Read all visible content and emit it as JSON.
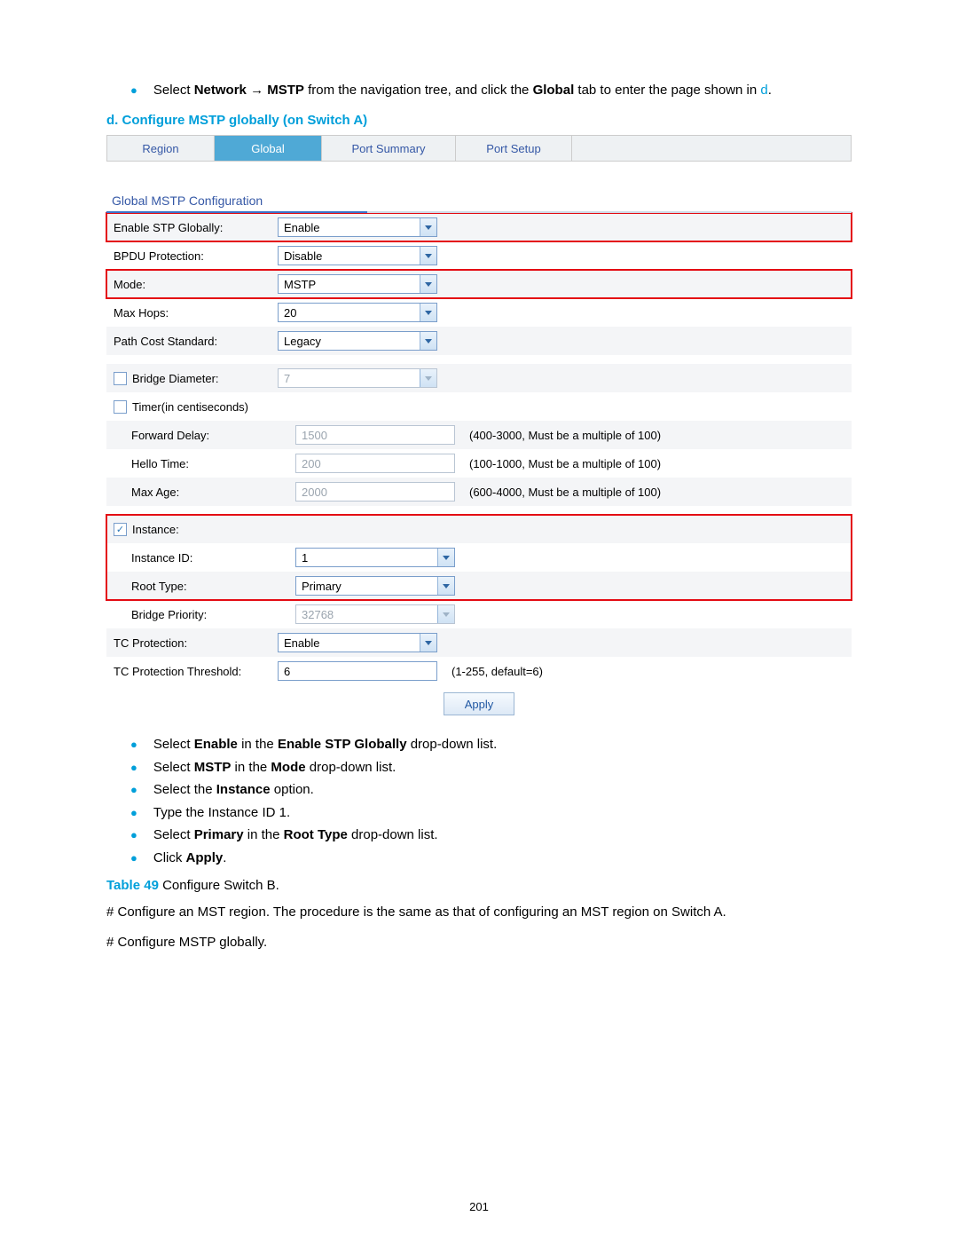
{
  "intro": {
    "pre": "Select ",
    "b1": "Network",
    "arrow": " → ",
    "b2": "MSTP",
    "mid": " from the navigation tree, and click the ",
    "b3": "Global",
    "post": " tab to enter the page shown in ",
    "link": "d",
    "dot": "."
  },
  "section_d": "d.   Configure MSTP globally (on Switch A)",
  "tabs": {
    "region": "Region",
    "global": "Global",
    "port_summary": "Port Summary",
    "port_setup": "Port Setup"
  },
  "panel_title": "Global MSTP Configuration",
  "fields": {
    "enable_stp": {
      "label": "Enable STP Globally:",
      "value": "Enable"
    },
    "bpdu": {
      "label": "BPDU Protection:",
      "value": "Disable"
    },
    "mode": {
      "label": "Mode:",
      "value": "MSTP"
    },
    "max_hops": {
      "label": "Max Hops:",
      "value": "20"
    },
    "path_cost": {
      "label": "Path Cost Standard:",
      "value": "Legacy"
    },
    "bridge_diameter": {
      "label": "Bridge Diameter:",
      "value": "7"
    },
    "timer": {
      "label": "Timer(in centiseconds)"
    },
    "fwd_delay": {
      "label": "Forward Delay:",
      "value": "1500",
      "hint": "(400-3000, Must be a multiple of 100)"
    },
    "hello": {
      "label": "Hello Time:",
      "value": "200",
      "hint": "(100-1000, Must be a multiple of 100)"
    },
    "max_age": {
      "label": "Max Age:",
      "value": "2000",
      "hint": "(600-4000, Must be a multiple of 100)"
    },
    "instance": {
      "label": "Instance:"
    },
    "instance_id": {
      "label": "Instance ID:",
      "value": "1"
    },
    "root_type": {
      "label": "Root Type:",
      "value": "Primary"
    },
    "bridge_priority": {
      "label": "Bridge Priority:",
      "value": "32768"
    },
    "tc_prot": {
      "label": "TC Protection:",
      "value": "Enable"
    },
    "tc_thresh": {
      "label": "TC Protection Threshold:",
      "value": "6",
      "hint": "(1-255, default=6)"
    }
  },
  "apply": "Apply",
  "instructions": {
    "i1": {
      "pre": "Select ",
      "b1": "Enable",
      "mid": " in the ",
      "b2": "Enable STP Globally",
      "post": " drop-down list."
    },
    "i2": {
      "pre": "Select ",
      "b1": "MSTP",
      "mid": " in the ",
      "b2": "Mode",
      "post": " drop-down list."
    },
    "i3": {
      "pre": "Select the ",
      "b1": "Instance",
      "post": " option."
    },
    "i4": {
      "text": "Type the Instance ID 1."
    },
    "i5": {
      "pre": "Select ",
      "b1": "Primary",
      "mid": " in the ",
      "b2": "Root Type",
      "post": " drop-down list."
    },
    "i6": {
      "pre": "Click ",
      "b1": "Apply",
      "post": "."
    }
  },
  "table_caption": {
    "label": "Table 49",
    "rest": " Configure Switch B."
  },
  "para1": "# Configure an MST region. The procedure is the same as that of configuring an MST region on Switch A.",
  "para2": "# Configure MSTP globally.",
  "page_number": "201"
}
